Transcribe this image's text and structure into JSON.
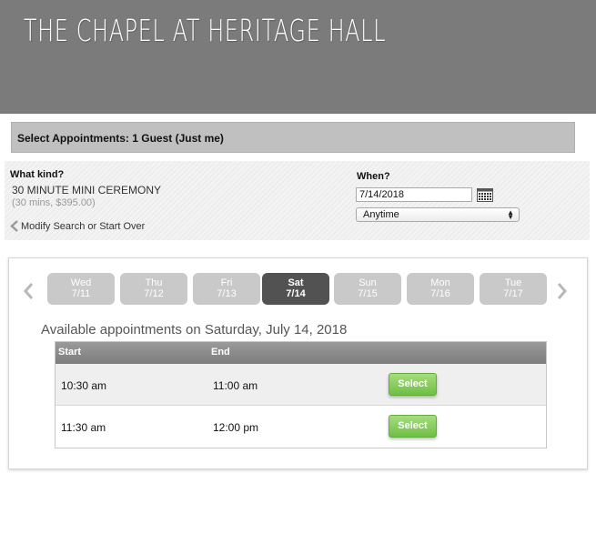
{
  "header": {
    "title": "THE CHAPEL AT HERITAGE HALL"
  },
  "selection_bar": {
    "text": "Select Appointments: 1 Guest (Just me)"
  },
  "search": {
    "kind_label": "What kind?",
    "kind_value": "30 MINUTE MINI CEREMONY",
    "kind_detail": "(30 mins, $395.00)",
    "modify_link": "Modify Search or Start Over",
    "when_label": "When?",
    "date_value": "7/14/2018",
    "time_selected": "Anytime"
  },
  "days": [
    {
      "dow": "Wed",
      "date": "7/11",
      "active": false
    },
    {
      "dow": "Thu",
      "date": "7/12",
      "active": false
    },
    {
      "dow": "Fri",
      "date": "7/13",
      "active": false
    },
    {
      "dow": "Sat",
      "date": "7/14",
      "active": true
    },
    {
      "dow": "Sun",
      "date": "7/15",
      "active": false
    },
    {
      "dow": "Mon",
      "date": "7/16",
      "active": false
    },
    {
      "dow": "Tue",
      "date": "7/17",
      "active": false
    }
  ],
  "availability": {
    "heading": "Available appointments on Saturday, July 14, 2018",
    "columns": {
      "start": "Start",
      "end": "End"
    },
    "rows": [
      {
        "start": "10:30 am",
        "end": "11:00 am",
        "action": "Select"
      },
      {
        "start": "11:30 am",
        "end": "12:00 pm",
        "action": "Select"
      }
    ]
  },
  "icons": {
    "prev": "chevron-left-icon",
    "next": "chevron-right-icon",
    "calendar": "calendar-icon",
    "select_arrows": "up-down-arrows-icon"
  },
  "colors": {
    "header_bg": "#7b7b7b",
    "active_day": "#525252",
    "inactive_day": "#c9c9c9",
    "select_button": "#7ec956"
  }
}
